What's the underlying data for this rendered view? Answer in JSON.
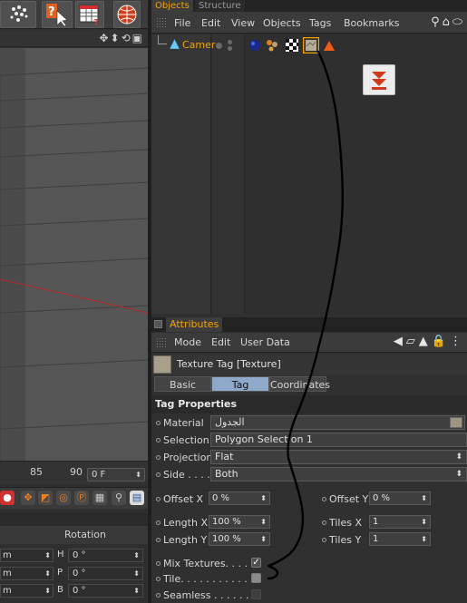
{
  "object_manager": {
    "tabs": [
      {
        "label": "Objects",
        "active": true
      },
      {
        "label": "Structure",
        "active": false
      }
    ],
    "menu": [
      "File",
      "Edit",
      "View",
      "Objects",
      "Tags",
      "Bookmarks"
    ],
    "object_name": "Camer"
  },
  "timeline": {
    "ticks": [
      "85",
      "90"
    ],
    "frame_value": "0 F"
  },
  "coordinates": {
    "title": "Rotation",
    "rows": [
      {
        "left": "m",
        "axis": "H",
        "value": "0 °"
      },
      {
        "left": "m",
        "axis": "P",
        "value": "0 °"
      },
      {
        "left": "m",
        "axis": "B",
        "value": "0 °"
      }
    ]
  },
  "attributes": {
    "tab_label": "Attributes",
    "menu": [
      "Mode",
      "Edit",
      "User Data"
    ],
    "title": "Texture Tag [Texture]",
    "subtabs": [
      {
        "label": "Basic",
        "active": false
      },
      {
        "label": "Tag",
        "active": true
      },
      {
        "label": "Coordinates",
        "active": false
      }
    ],
    "section": "Tag Properties",
    "material": {
      "label": "Material",
      "value": "الجدول"
    },
    "selection": {
      "label": "Selection",
      "value": "Polygon Selection 1"
    },
    "projection": {
      "label": "Projection",
      "value": "Flat"
    },
    "side": {
      "label": "Side . . . .",
      "value": "Both"
    },
    "offset_x": {
      "label": "Offset X",
      "value": "0 %"
    },
    "offset_y": {
      "label": "Offset Y",
      "value": "0 %"
    },
    "length_x": {
      "label": "Length X",
      "value": "100 %"
    },
    "length_y": {
      "label": "Length Y",
      "value": "100 %"
    },
    "tiles_x": {
      "label": "Tiles X",
      "value": "1"
    },
    "tiles_y": {
      "label": "Tiles Y",
      "value": "1"
    },
    "mix_textures": {
      "label": "Mix Textures. . . . . .",
      "checked": true
    },
    "tile": {
      "label": "Tile. . . . . . . . . . . .",
      "checked": false
    },
    "seamless": {
      "label": "Seamless . . . . . . . .",
      "checked": false
    }
  },
  "colors": {
    "accent_orange": "#f5a200",
    "active_tab_blue": "#8ea9c9",
    "annotation_stroke": "#000000"
  }
}
